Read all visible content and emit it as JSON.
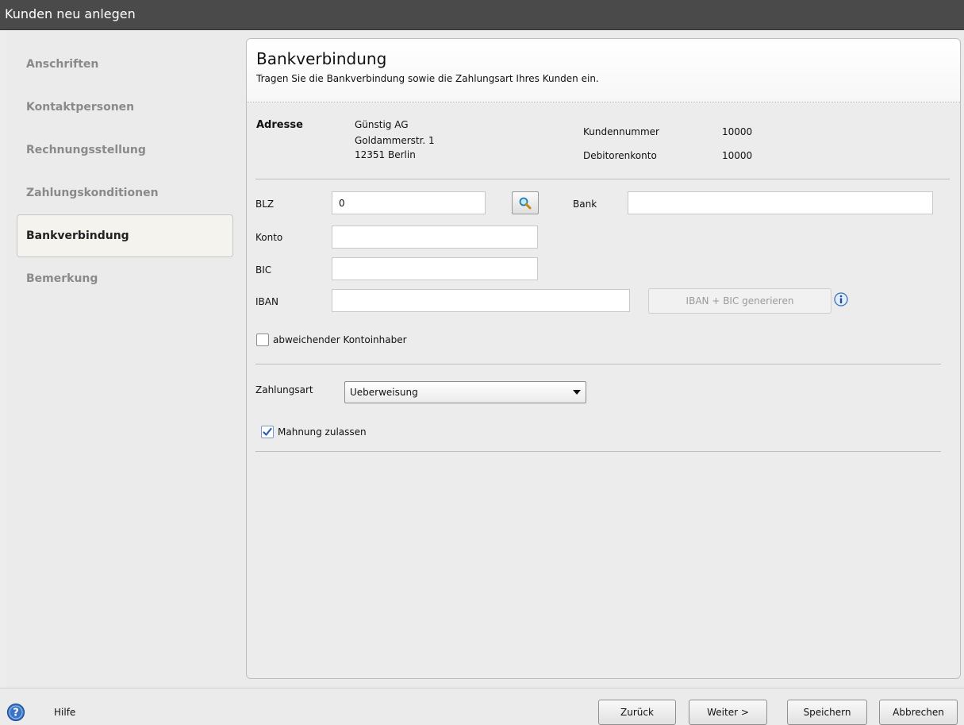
{
  "window": {
    "title": "Kunden neu anlegen"
  },
  "sidebar": {
    "items": [
      {
        "label": "Anschriften"
      },
      {
        "label": "Kontaktpersonen"
      },
      {
        "label": "Rechnungsstellung"
      },
      {
        "label": "Zahlungskonditionen"
      },
      {
        "label": "Bankverbindung",
        "active": true
      },
      {
        "label": "Bemerkung"
      }
    ]
  },
  "header": {
    "title": "Bankverbindung",
    "subtitle": "Tragen Sie die Bankverbindung sowie die Zahlungsart Ihres Kunden ein."
  },
  "address": {
    "label": "Adresse",
    "lines": [
      "Günstig AG",
      "Goldammerstr. 1",
      "12351 Berlin"
    ],
    "kundennummer_label": "Kundennummer",
    "kundennummer": "10000",
    "debitorenkonto_label": "Debitorenkonto",
    "debitorenkonto": "10000"
  },
  "bank": {
    "blz_label": "BLZ",
    "blz_value": "0",
    "bank_label": "Bank",
    "bank_value": "",
    "konto_label": "Konto",
    "konto_value": "",
    "bic_label": "BIC",
    "bic_value": "",
    "iban_label": "IBAN",
    "iban_value": "",
    "generate_label": "IBAN + BIC generieren",
    "other_holder_label": "abweichender Kontoinhaber",
    "other_holder_checked": false
  },
  "payment": {
    "label": "Zahlungsart",
    "selected": "Ueberweisung",
    "dunning_label": "Mahnung zulassen",
    "dunning_checked": true
  },
  "footer": {
    "help_label": "Hilfe",
    "back_label": "Zurück",
    "next_label": "Weiter >",
    "save_label": "Speichern",
    "cancel_label": "Abbrechen"
  },
  "colors": {
    "titlebar": "#4a4a4a",
    "active_nav_bg": "#f4f3ee",
    "check_blue": "#2a5db0",
    "help_blue": "#3b74c4"
  }
}
